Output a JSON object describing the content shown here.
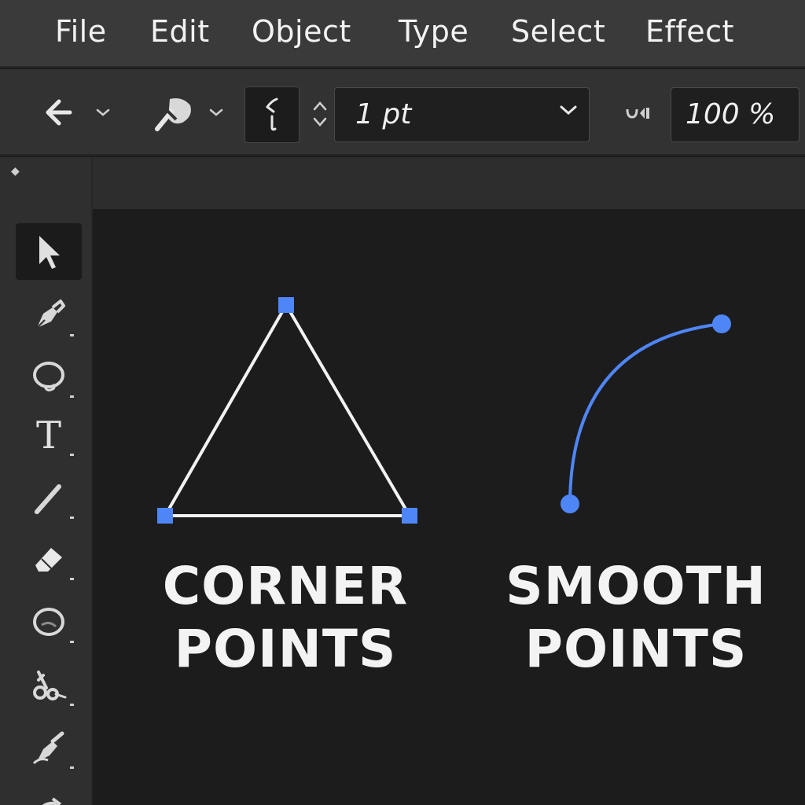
{
  "menubar": {
    "items": [
      {
        "id": "file",
        "label": "File"
      },
      {
        "id": "edit",
        "label": "Edit"
      },
      {
        "id": "object",
        "label": "Object"
      },
      {
        "id": "type",
        "label": "Type"
      },
      {
        "id": "select",
        "label": "Select"
      },
      {
        "id": "effect",
        "label": "Effect"
      }
    ]
  },
  "controlbar": {
    "stroke_weight": "1 pt",
    "opacity": "100 %",
    "icons": [
      "back-arrow-icon",
      "fill-brush-icon",
      "stroke-swatch-icon",
      "stepper-icon",
      "opacity-icon"
    ]
  },
  "tools": {
    "items": [
      {
        "name": "selection-tool",
        "icon": "selection-arrow-icon",
        "active": true
      },
      {
        "name": "pen-tool",
        "icon": "pen-nib-icon"
      },
      {
        "name": "lasso-tool",
        "icon": "lasso-icon"
      },
      {
        "name": "type-tool",
        "icon": "type-t-icon",
        "glyph": "T"
      },
      {
        "name": "pencil-tool",
        "icon": "pencil-icon"
      },
      {
        "name": "eraser-tool",
        "icon": "eraser-icon"
      },
      {
        "name": "ellipse-tool",
        "icon": "ellipse-icon"
      },
      {
        "name": "scissors-tool",
        "icon": "scissors-icon"
      },
      {
        "name": "direct-pen-tool",
        "icon": "anchor-pen-icon"
      },
      {
        "name": "rotate-tool",
        "icon": "rotate-icon"
      }
    ]
  },
  "canvas": {
    "corner_label": {
      "line1": "CORNER",
      "line2": "POINTS"
    },
    "smooth_label": {
      "line1": "SMOOTH",
      "line2": "POINTS"
    },
    "anchor_color": "#4f86f7",
    "path_color_corner": "#f2f2f2",
    "path_color_smooth": "#4f86f7"
  }
}
